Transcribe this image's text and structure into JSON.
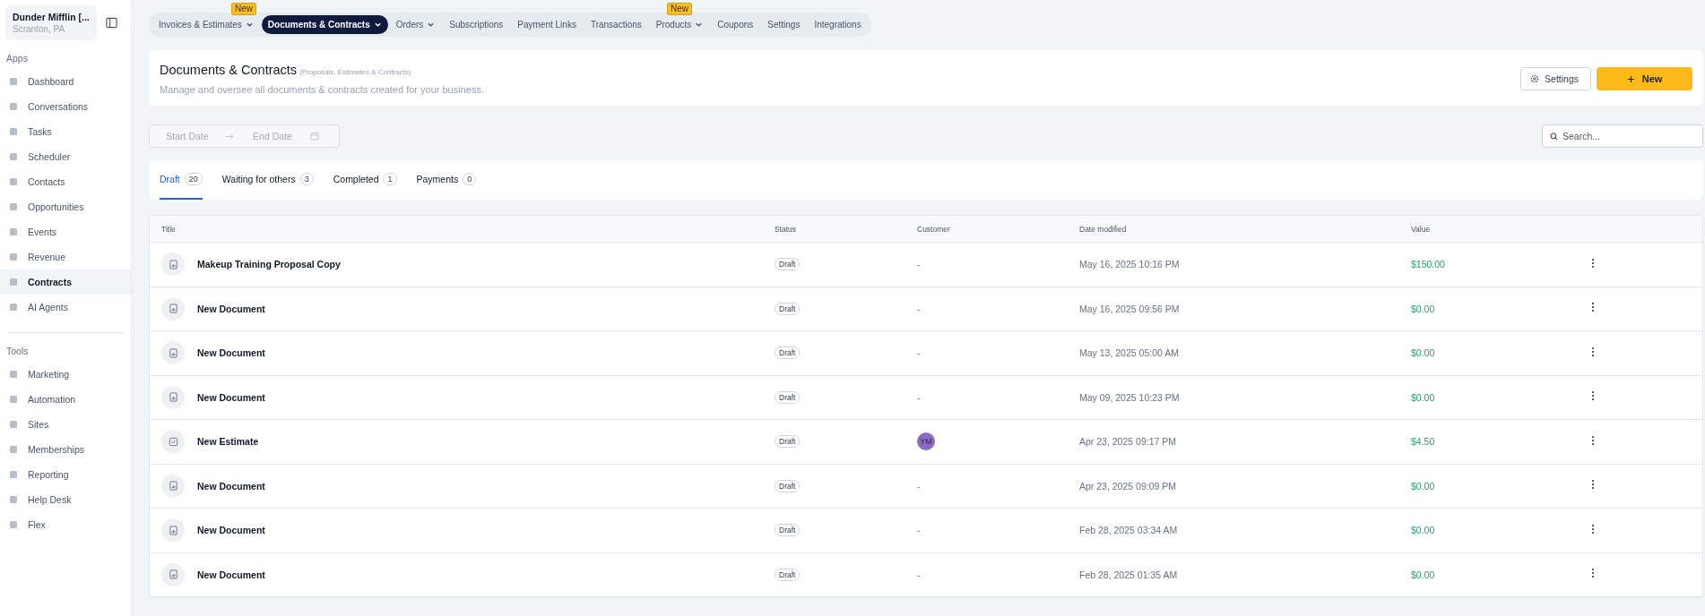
{
  "account": {
    "name": "Dunder Mifflin [...",
    "location": "Scranton, PA"
  },
  "sidebar": {
    "groups": [
      {
        "heading": "Apps",
        "items": [
          {
            "label": "Dashboard",
            "selected": false
          },
          {
            "label": "Conversations",
            "selected": false
          },
          {
            "label": "Tasks",
            "selected": false
          },
          {
            "label": "Scheduler",
            "selected": false
          },
          {
            "label": "Contacts",
            "selected": false
          },
          {
            "label": "Opportunities",
            "selected": false
          },
          {
            "label": "Events",
            "selected": false
          },
          {
            "label": "Revenue",
            "selected": false
          },
          {
            "label": "Contracts",
            "selected": true
          },
          {
            "label": "AI Agents",
            "selected": false
          }
        ]
      },
      {
        "heading": "Tools",
        "items": [
          {
            "label": "Marketing",
            "selected": false
          },
          {
            "label": "Automation",
            "selected": false
          },
          {
            "label": "Sites",
            "selected": false
          },
          {
            "label": "Memberships",
            "selected": false
          },
          {
            "label": "Reporting",
            "selected": false
          },
          {
            "label": "Help Desk",
            "selected": false
          },
          {
            "label": "Flex",
            "selected": false
          }
        ]
      }
    ]
  },
  "top_nav": [
    {
      "label": "Invoices & Estimates",
      "dropdown": true,
      "selected": false,
      "badge": "New"
    },
    {
      "label": "Documents & Contracts",
      "dropdown": true,
      "selected": true
    },
    {
      "label": "Orders",
      "dropdown": true,
      "selected": false
    },
    {
      "label": "Subscriptions",
      "dropdown": false,
      "selected": false
    },
    {
      "label": "Payment Links",
      "dropdown": false,
      "selected": false
    },
    {
      "label": "Transactions",
      "dropdown": false,
      "selected": false
    },
    {
      "label": "Products",
      "dropdown": true,
      "selected": false,
      "badge": "New"
    },
    {
      "label": "Coupons",
      "dropdown": false,
      "selected": false
    },
    {
      "label": "Settings",
      "dropdown": false,
      "selected": false
    },
    {
      "label": "Integrations",
      "dropdown": false,
      "selected": false
    }
  ],
  "header": {
    "title": "Documents & Contracts",
    "subtitle": "(Proposals, Estimates & Contracts)",
    "description": "Manage and oversee all documents & contracts created for your business.",
    "settings_button": "Settings",
    "new_button": "New"
  },
  "date_range": {
    "start_placeholder": "Start Date",
    "end_placeholder": "End Date"
  },
  "search": {
    "placeholder": "Search..."
  },
  "tabs": [
    {
      "label": "Draft",
      "count": "20",
      "selected": true
    },
    {
      "label": "Waiting for others",
      "count": "3",
      "selected": false
    },
    {
      "label": "Completed",
      "count": "1",
      "selected": false
    },
    {
      "label": "Payments",
      "count": "0",
      "selected": false
    }
  ],
  "table": {
    "columns": [
      "Title",
      "Status",
      "Customer",
      "Date modified",
      "Value"
    ],
    "rows": [
      {
        "kind": "document",
        "title": "Makeup Training Proposal Copy",
        "status": "Draft",
        "customer": "-",
        "date": "May 16, 2025 10:16 PM",
        "value": "$150.00"
      },
      {
        "kind": "document",
        "title": "New Document",
        "status": "Draft",
        "customer": "-",
        "date": "May 16, 2025 09:56 PM",
        "value": "$0.00"
      },
      {
        "kind": "document",
        "title": "New Document",
        "status": "Draft",
        "customer": "-",
        "date": "May 13, 2025 05:00 AM",
        "value": "$0.00"
      },
      {
        "kind": "document",
        "title": "New Document",
        "status": "Draft",
        "customer": "-",
        "date": "May 09, 2025 10:23 PM",
        "value": "$0.00"
      },
      {
        "kind": "estimate",
        "title": "New Estimate",
        "status": "Draft",
        "customer_initials": "YM",
        "date": "Apr 23, 2025 09:17 PM",
        "value": "$4.50"
      },
      {
        "kind": "document",
        "title": "New Document",
        "status": "Draft",
        "customer": "-",
        "date": "Apr 23, 2025 09:09 PM",
        "value": "$0.00"
      },
      {
        "kind": "document",
        "title": "New Document",
        "status": "Draft",
        "customer": "-",
        "date": "Feb 28, 2025 03:34 AM",
        "value": "$0.00"
      },
      {
        "kind": "document",
        "title": "New Document",
        "status": "Draft",
        "customer": "-",
        "date": "Feb 28, 2025 01:35 AM",
        "value": "$0.00"
      }
    ]
  }
}
